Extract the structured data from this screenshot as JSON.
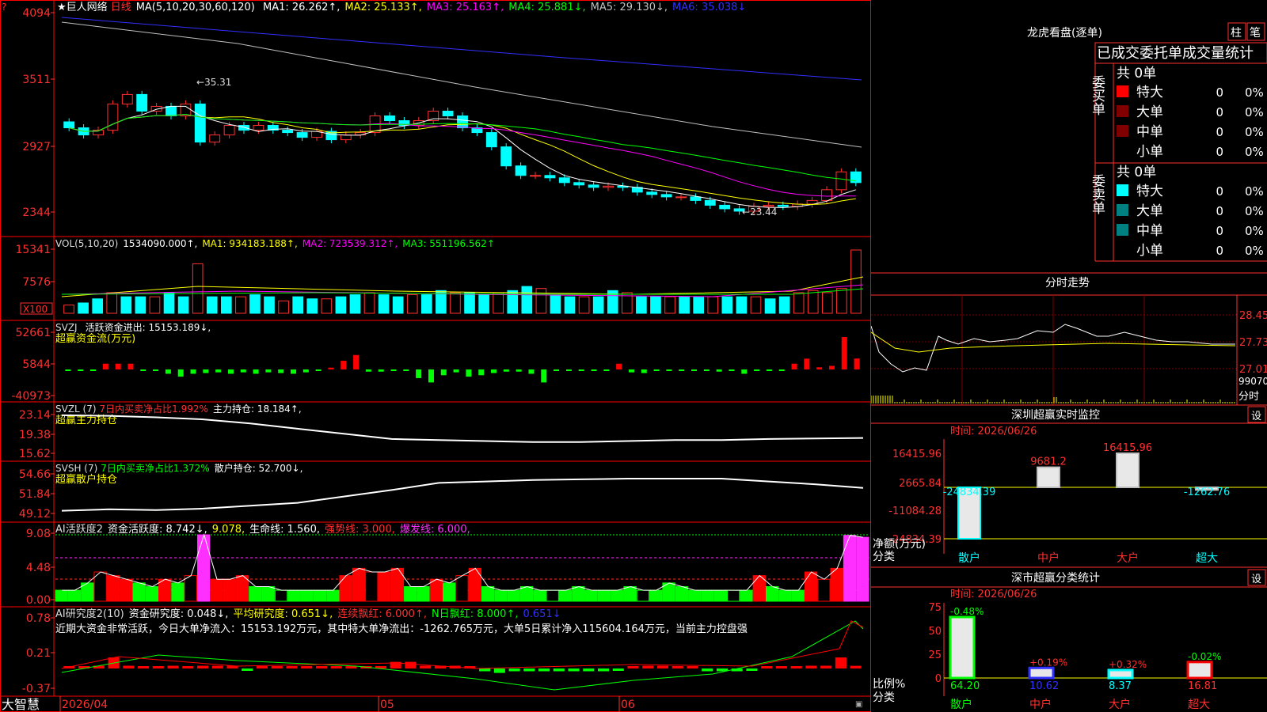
{
  "stock": {
    "name": "巨人网络",
    "period": "日线"
  },
  "ma_panel": {
    "label": "MA(5,10,20,30,60,120)",
    "items": [
      {
        "text": "MA1: 26.262↑,",
        "color": "#ffffff"
      },
      {
        "text": "MA2: 25.133↑,",
        "color": "#ffff00"
      },
      {
        "text": "MA3: 25.163↑,",
        "color": "#ff00ff"
      },
      {
        "text": "MA4: 25.881↓,",
        "color": "#00ff00"
      },
      {
        "text": "MA5: 29.130↓,",
        "color": "#c0c0c0"
      },
      {
        "text": "MA6: 35.038↓",
        "color": "#3030ff"
      }
    ],
    "y_ticks": [
      "4094",
      "3511",
      "2927",
      "2344"
    ],
    "high_mark": "35.31",
    "low_mark": "23.44"
  },
  "vol_panel": {
    "label": "VOL(5,10,20)",
    "items": [
      {
        "text": "1534090.000↑,",
        "color": "#ffffff"
      },
      {
        "text": "MA1: 934183.188↑,",
        "color": "#ffff00"
      },
      {
        "text": "MA2: 723539.312↑,",
        "color": "#ff00ff"
      },
      {
        "text": "MA3: 551196.562↑",
        "color": "#00ff00"
      }
    ],
    "y_ticks": [
      "15341",
      "7576"
    ],
    "unit": "X100"
  },
  "svzj_panel": {
    "label": "SVZJ",
    "item": "活跃资金进出: 15153.189↓,",
    "subtitle": "超赢资金流(万元)",
    "y_ticks": [
      "52661",
      "5844",
      "-40973"
    ]
  },
  "svzl_panel": {
    "label": "SVZL (7)",
    "ratio": "7日内买卖净占比1.992%",
    "hold": "主力持仓: 18.184↑,",
    "subtitle": "超赢主力持仓",
    "y_ticks": [
      "23.14",
      "19.38",
      "15.62"
    ]
  },
  "svsh_panel": {
    "label": "SVSH (7)",
    "ratio": "7日内买卖净占比1.372%",
    "hold": "散户持仓: 52.700↓,",
    "subtitle": "超赢散户持仓",
    "y_ticks": [
      "54.66",
      "51.84",
      "49.12"
    ]
  },
  "ai_active_panel": {
    "label": "AI活跃度2",
    "items": [
      {
        "text": "资金活跃度: 8.742↓,",
        "color": "#ffffff"
      },
      {
        "text": "9.078,",
        "color": "#ffff00"
      },
      {
        "text": "生命线: 1.560,",
        "color": "#ffffff"
      },
      {
        "text": "强势线: 3.000,",
        "color": "#ff3030"
      },
      {
        "text": "爆发线: 6.000,",
        "color": "#ff30ff"
      }
    ],
    "y_ticks": [
      "9.08",
      "4.48",
      "0.00"
    ]
  },
  "ai_research_panel": {
    "label": "AI研究度2(10)",
    "items": [
      {
        "text": "资金研究度: 0.048↓,",
        "color": "#ffffff"
      },
      {
        "text": "平均研究度: 0.651↓,",
        "color": "#ffff00"
      },
      {
        "text": "连续飘红: 6.000↑,",
        "color": "#ff3030"
      },
      {
        "text": "N日飘红: 8.000↑,",
        "color": "#00ff00"
      },
      {
        "text": "0.651↓",
        "color": "#3030ff"
      }
    ],
    "comment": "近期大资金非常活跃，今日大单净流入：15153.192万元，其中特大单净流出：-1262.765万元，大单5日累计净入115604.164万元，当前主力控盘强",
    "y_ticks": [
      "0.78",
      "0.21",
      "-0.37"
    ]
  },
  "x_axis": {
    "labels": [
      "2026/04",
      "05",
      "06"
    ]
  },
  "brand": "大智慧",
  "dragon_tiger": {
    "title": "龙虎看盘(逐单)",
    "btn_bar": "柱",
    "btn_pen": "笔",
    "header": "已成交委托单成交量统计",
    "buy_label": "委买单",
    "sell_label": "委卖单",
    "buy_total": "共 0单",
    "sell_total": "共 0单",
    "buy_rows": [
      {
        "label": "特大",
        "count": "0",
        "pct": "0%",
        "color": "#ff0000"
      },
      {
        "label": "大单",
        "count": "0",
        "pct": "0%",
        "color": "#800000"
      },
      {
        "label": "中单",
        "count": "0",
        "pct": "0%",
        "color": "#800000"
      },
      {
        "label": "小单",
        "count": "0",
        "pct": "0%",
        "color": ""
      }
    ],
    "sell_rows": [
      {
        "label": "特大",
        "count": "0",
        "pct": "0%",
        "color": "#00ffff"
      },
      {
        "label": "大单",
        "count": "0",
        "pct": "0%",
        "color": "#008080"
      },
      {
        "label": "中单",
        "count": "0",
        "pct": "0%",
        "color": "#008080"
      },
      {
        "label": "小单",
        "count": "0",
        "pct": "0%",
        "color": ""
      }
    ]
  },
  "intraday": {
    "title": "分时走势",
    "y_ticks": [
      "28.45",
      "27.73",
      "27.01"
    ],
    "vol_label": "99070",
    "vol_unit": "分时"
  },
  "sz_monitor": {
    "title": "深圳超赢实时监控",
    "setting": "设",
    "time": "时间: 2026/06/26",
    "y_ticks": [
      "16415.96",
      "2665.84",
      "-11084.28",
      "-24834.39"
    ],
    "y_label": "净额(万元)",
    "x_label": "分类",
    "categories": [
      "散户",
      "中户",
      "大户",
      "超大"
    ],
    "values": [
      -24834.39,
      9681.2,
      16415.96,
      -1262.76
    ],
    "value_labels": [
      "-24834.39",
      "9681.2",
      "16415.96",
      "-1262.76"
    ]
  },
  "sz_class": {
    "title": "深市超赢分类统计",
    "setting": "设",
    "time": "时间: 2026/06/26",
    "y_ticks": [
      "75",
      "50",
      "25",
      "0"
    ],
    "y_label": "比例%",
    "x_label": "分类",
    "categories": [
      "散户",
      "中户",
      "大户",
      "超大"
    ],
    "values": [
      64.2,
      10.62,
      8.37,
      16.81
    ],
    "value_labels": [
      "64.20",
      "10.62",
      "8.37",
      "16.81"
    ],
    "changes": [
      "-0.48%",
      "+0.19%",
      "+0.32%",
      "-0.02%"
    ]
  },
  "colors": {
    "up": "#ff3030",
    "down": "#00ffff",
    "grid": "#ff0000",
    "axis": "#ff3030"
  },
  "chart_data": [
    {
      "type": "candlestick",
      "title": "巨人网络 日线",
      "candles_close": [
        31.2,
        30.6,
        31.0,
        33.2,
        34.0,
        32.6,
        33.0,
        32.2,
        33.2,
        30.0,
        30.6,
        31.4,
        31.0,
        31.4,
        31.0,
        30.8,
        30.4,
        30.9,
        30.2,
        30.6,
        30.8,
        32.2,
        31.8,
        31.4,
        31.8,
        32.6,
        32.2,
        31.2,
        30.8,
        29.6,
        28.0,
        27.2,
        27.2,
        27.0,
        26.6,
        26.4,
        26.2,
        26.3,
        26.2,
        25.8,
        25.6,
        25.4,
        25.4,
        25.1,
        24.7,
        24.4,
        24.2,
        24.6,
        24.7,
        24.6,
        24.8,
        25.1,
        26.0,
        27.5,
        26.6
      ],
      "ylim": [
        23.0,
        41.0
      ],
      "high": 35.31,
      "low": 23.44,
      "ma": {
        "MA1": 26.262,
        "MA2": 25.133,
        "MA3": 25.163,
        "MA4": 25.881,
        "MA5": 29.13,
        "MA6": 35.038
      }
    },
    {
      "type": "bar",
      "title": "VOL(5,10,20)",
      "values": [
        1534090
      ],
      "ma": {
        "MA1": 934183.188,
        "MA2": 723539.312,
        "MA3": 551196.562
      }
    },
    {
      "type": "bar",
      "title": "SVZJ",
      "values": [
        -2000,
        -1500,
        -1000,
        8000,
        8000,
        8000,
        -200,
        -200,
        -6000,
        -10000,
        -6000,
        -5000,
        -4000,
        -6000,
        -4000,
        -6000,
        -4000,
        -5000,
        -6000,
        -4000,
        -2000,
        2500,
        12000,
        20000,
        -3000,
        -3000,
        -2000,
        -2000,
        -12000,
        -18000,
        -8000,
        -4000,
        -10000,
        -8000,
        -5000,
        -3000,
        -3000,
        -6000,
        -18000,
        -2000,
        -2000,
        -2000,
        -2000,
        -2000,
        8000,
        -4000,
        -5000,
        -2000,
        -2000,
        -2000,
        -2000,
        -2000,
        -3000,
        -2000,
        -6000,
        -2000,
        -2000,
        -2000,
        8000,
        15000,
        3000,
        5000,
        45000,
        15153
      ]
    },
    {
      "type": "line",
      "title": "SVZL (7)",
      "values": [
        23.0,
        22.9,
        22.6,
        22.2,
        21.4,
        20.4,
        19.4,
        18.4,
        18.2,
        18.0,
        17.8,
        17.8,
        18.0,
        18.2,
        18.2,
        18.4,
        18.5,
        18.6
      ],
      "ylim": [
        15.62,
        23.14
      ]
    },
    {
      "type": "line",
      "title": "SVSH (7)",
      "values": [
        49.5,
        49.7,
        49.6,
        49.8,
        50.2,
        50.6,
        51.5,
        52.4,
        53.4,
        53.6,
        53.8,
        53.9,
        54.0,
        54.0,
        54.0,
        53.6,
        53.2,
        52.7
      ],
      "ylim": [
        49.12,
        54.66
      ]
    },
    {
      "type": "bar",
      "title": "AI活跃度2",
      "values": [
        1.5,
        1.5,
        2.5,
        4.0,
        3.5,
        3.0,
        2.5,
        2.0,
        3.0,
        2.5,
        3.5,
        9.08,
        3.0,
        3.0,
        3.5,
        2.0,
        2.0,
        1.5,
        1.5,
        1.5,
        1.5,
        1.5,
        3.5,
        4.5,
        4.0,
        4.0,
        4.5,
        2.0,
        2.0,
        3.0,
        2.5,
        3.5,
        4.5,
        2.0,
        1.5,
        1.5,
        2.0,
        1.5,
        1.5,
        1.5,
        2.0,
        1.5,
        1.5,
        1.5,
        2.0,
        1.5,
        1.5,
        2.5,
        2.0,
        1.5,
        1.5,
        1.5,
        1.5,
        1.5,
        3.5,
        2.0,
        1.5,
        1.5,
        4.0,
        3.0,
        4.5,
        9.0,
        8.742
      ],
      "ylim": [
        0,
        9.08
      ]
    },
    {
      "type": "bar",
      "title": "AI研究度2(10)",
      "values": [
        0,
        0,
        0.05,
        0.2,
        0.05,
        0.0,
        0.0,
        0.05,
        0.0,
        0.05,
        0.05,
        0.05,
        -0.02,
        0,
        0,
        0.02,
        0,
        0,
        0,
        0,
        0,
        0,
        0.12,
        0.12,
        0.05,
        0.05,
        0.05,
        0,
        -0.05,
        -0.08,
        -0.05,
        -0.05,
        -0.05,
        -0.05,
        -0.05,
        -0.05,
        -0.05,
        -0.02,
        0.0,
        0.05,
        0.05,
        0.02,
        0,
        -0.05,
        -0.05,
        -0.05,
        -0.02,
        0.02,
        0.02,
        0.02,
        0.05,
        0.05,
        0.2,
        0.048
      ],
      "ylim": [
        -0.37,
        0.78
      ]
    },
    {
      "type": "bar",
      "title": "深圳超赢实时监控",
      "categories": [
        "散户",
        "中户",
        "大户",
        "超大"
      ],
      "values": [
        -24834.39,
        9681.2,
        16415.96,
        -1262.76
      ],
      "ylim": [
        -24834.39,
        16415.96
      ],
      "ylabel": "净额(万元)",
      "xlabel": "分类"
    },
    {
      "type": "bar",
      "title": "深市超赢分类统计",
      "categories": [
        "散户",
        "中户",
        "大户",
        "超大"
      ],
      "values": [
        64.2,
        10.62,
        8.37,
        16.81
      ],
      "ylim": [
        0,
        75
      ],
      "ylabel": "比例%",
      "xlabel": "分类"
    }
  ]
}
